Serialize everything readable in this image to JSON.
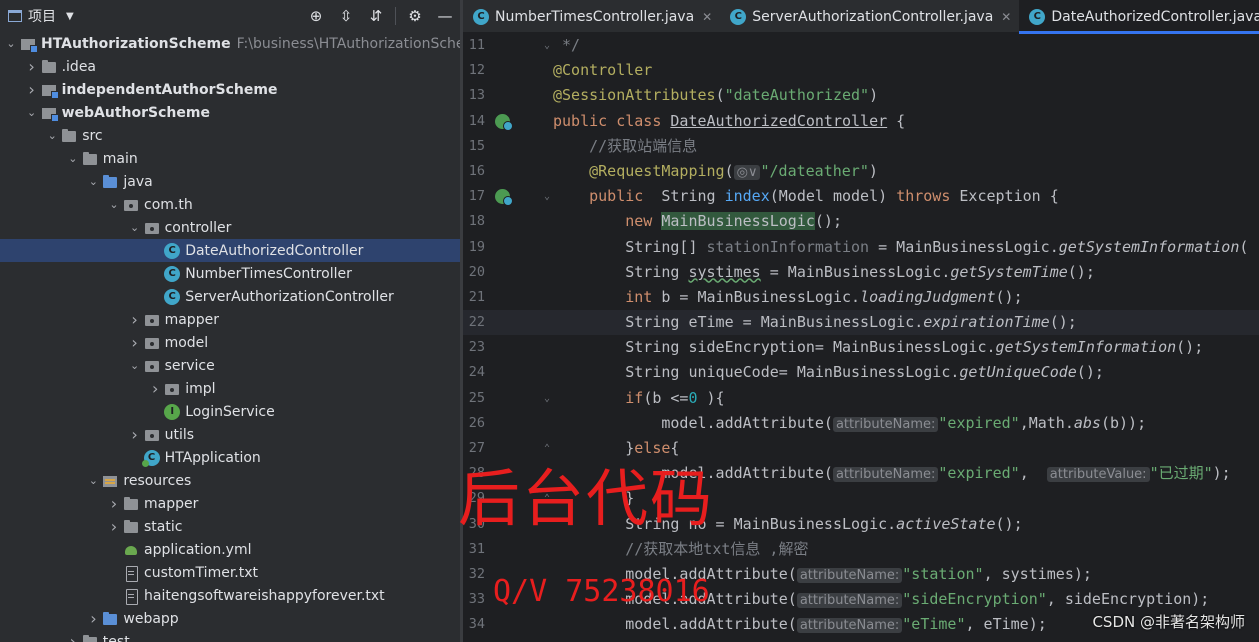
{
  "project_panel": {
    "title": "项目",
    "tree": [
      {
        "label": "HTAuthorizationScheme",
        "path": "F:\\business\\HTAuthorizationSchem",
        "depth": 0,
        "arrow": "down",
        "icon": "module-icon",
        "bold": true
      },
      {
        "label": ".idea",
        "depth": 1,
        "arrow": "right",
        "icon": "folder-icon"
      },
      {
        "label": "independentAuthorScheme",
        "depth": 1,
        "arrow": "right",
        "icon": "module-icon",
        "bold": true
      },
      {
        "label": "webAuthorScheme",
        "depth": 1,
        "arrow": "down",
        "icon": "module-icon",
        "bold": true
      },
      {
        "label": "src",
        "depth": 2,
        "arrow": "down",
        "icon": "folder-icon"
      },
      {
        "label": "main",
        "depth": 3,
        "arrow": "down",
        "icon": "folder-icon"
      },
      {
        "label": "java",
        "depth": 4,
        "arrow": "down",
        "icon": "source-folder-icon"
      },
      {
        "label": "com.th",
        "depth": 5,
        "arrow": "down",
        "icon": "package-icon"
      },
      {
        "label": "controller",
        "depth": 6,
        "arrow": "down",
        "icon": "package-icon"
      },
      {
        "label": "DateAuthorizedController",
        "depth": 7,
        "arrow": "none",
        "icon": "class-icon",
        "selected": true
      },
      {
        "label": "NumberTimesController",
        "depth": 7,
        "arrow": "none",
        "icon": "class-icon"
      },
      {
        "label": "ServerAuthorizationController",
        "depth": 7,
        "arrow": "none",
        "icon": "class-icon"
      },
      {
        "label": "mapper",
        "depth": 6,
        "arrow": "right",
        "icon": "package-icon"
      },
      {
        "label": "model",
        "depth": 6,
        "arrow": "right",
        "icon": "package-icon"
      },
      {
        "label": "service",
        "depth": 6,
        "arrow": "down",
        "icon": "package-icon"
      },
      {
        "label": "impl",
        "depth": 7,
        "arrow": "right",
        "icon": "package-icon"
      },
      {
        "label": "LoginService",
        "depth": 7,
        "arrow": "none",
        "icon": "interface-icon"
      },
      {
        "label": "utils",
        "depth": 6,
        "arrow": "right",
        "icon": "package-icon"
      },
      {
        "label": "HTApplication",
        "depth": 6,
        "arrow": "none",
        "icon": "spring-app-icon"
      },
      {
        "label": "resources",
        "depth": 4,
        "arrow": "down",
        "icon": "resources-folder-icon"
      },
      {
        "label": "mapper",
        "depth": 5,
        "arrow": "right",
        "icon": "folder-icon"
      },
      {
        "label": "static",
        "depth": 5,
        "arrow": "right",
        "icon": "folder-icon"
      },
      {
        "label": "application.yml",
        "depth": 5,
        "arrow": "none",
        "icon": "yaml-icon"
      },
      {
        "label": "customTimer.txt",
        "depth": 5,
        "arrow": "none",
        "icon": "text-file-icon"
      },
      {
        "label": "haitengsoftwareishappyforever.txt",
        "depth": 5,
        "arrow": "none",
        "icon": "text-file-icon"
      },
      {
        "label": "webapp",
        "depth": 4,
        "arrow": "right",
        "icon": "web-folder-icon"
      },
      {
        "label": "test",
        "depth": 3,
        "arrow": "right",
        "icon": "folder-icon"
      }
    ]
  },
  "tabs": [
    {
      "label": "NumberTimesController.java",
      "active": false
    },
    {
      "label": "ServerAuthorizationController.java",
      "active": false
    },
    {
      "label": "DateAuthorizedController.java",
      "active": true
    }
  ],
  "code": {
    "current_line": 22,
    "lines": [
      {
        "n": 11,
        "fold": "⌄",
        "tokens": [
          [
            "cm",
            " */"
          ]
        ]
      },
      {
        "n": 12,
        "tokens": [
          [
            "an",
            "@Controller"
          ]
        ]
      },
      {
        "n": 13,
        "tokens": [
          [
            "an",
            "@SessionAttributes"
          ],
          [
            "",
            "("
          ],
          [
            "str",
            "\"dateAuthorized\""
          ],
          [
            "",
            ")"
          ]
        ]
      },
      {
        "n": 14,
        "run": true,
        "tokens": [
          [
            "kw",
            "public class "
          ],
          [
            "ul",
            "DateAuthorizedController"
          ],
          [
            "",
            " {"
          ]
        ]
      },
      {
        "n": 15,
        "tokens": [
          [
            "cm",
            "    //获取站端信息"
          ]
        ]
      },
      {
        "n": 16,
        "tokens": [
          [
            "",
            "    "
          ],
          [
            "an",
            "@RequestMapping"
          ],
          [
            "",
            "("
          ],
          [
            "hint",
            "◎∨"
          ],
          [
            "str",
            "\"/dateather\""
          ],
          [
            "",
            ")"
          ]
        ]
      },
      {
        "n": 17,
        "run": true,
        "fold": "⌄",
        "tokens": [
          [
            "",
            "    "
          ],
          [
            "kw",
            "public"
          ],
          [
            "",
            "  String "
          ],
          [
            "fn",
            "index"
          ],
          [
            "",
            "(Model model) "
          ],
          [
            "kw",
            "throws"
          ],
          [
            "",
            " Exception {"
          ]
        ]
      },
      {
        "n": 18,
        "tokens": [
          [
            "",
            "        "
          ],
          [
            "kw",
            "new "
          ],
          [
            "hl",
            "MainBusinessLogic"
          ],
          [
            "",
            "();"
          ]
        ]
      },
      {
        "n": 19,
        "tokens": [
          [
            "",
            "        String[] "
          ],
          [
            "cm",
            "stationInformation"
          ],
          [
            "",
            " = MainBusinessLogic."
          ],
          [
            "it",
            "getSystemInformation"
          ],
          [
            "",
            "("
          ]
        ]
      },
      {
        "n": 20,
        "tokens": [
          [
            "",
            "        String "
          ],
          [
            "wv",
            "systimes"
          ],
          [
            "",
            " = MainBusinessLogic."
          ],
          [
            "it",
            "getSystemTime"
          ],
          [
            "",
            "();"
          ]
        ]
      },
      {
        "n": 21,
        "tokens": [
          [
            "",
            "        "
          ],
          [
            "kw",
            "int"
          ],
          [
            "",
            " b = MainBusinessLogic."
          ],
          [
            "it",
            "loadingJudgment"
          ],
          [
            "",
            "();"
          ]
        ]
      },
      {
        "n": 22,
        "tokens": [
          [
            "",
            "        String eTime = MainBusinessLogic."
          ],
          [
            "it",
            "expirationTime"
          ],
          [
            "",
            "();"
          ]
        ]
      },
      {
        "n": 23,
        "tokens": [
          [
            "",
            "        String sideEncryption= MainBusinessLogic."
          ],
          [
            "it",
            "getSystemInformation"
          ],
          [
            "",
            "();"
          ]
        ]
      },
      {
        "n": 24,
        "tokens": [
          [
            "",
            "        String uniqueCode= MainBusinessLogic."
          ],
          [
            "it",
            "getUniqueCode"
          ],
          [
            "",
            "();"
          ]
        ]
      },
      {
        "n": 25,
        "fold": "⌄",
        "tokens": [
          [
            "",
            "        "
          ],
          [
            "kw",
            "if"
          ],
          [
            "",
            "(b <="
          ],
          [
            "num",
            "0"
          ],
          [
            "",
            " ){"
          ]
        ]
      },
      {
        "n": 26,
        "tokens": [
          [
            "",
            "            model.addAttribute("
          ],
          [
            "hint",
            "attributeName:"
          ],
          [
            "str",
            "\"expired\""
          ],
          [
            "",
            ",Math."
          ],
          [
            "it",
            "abs"
          ],
          [
            "",
            "(b));"
          ]
        ]
      },
      {
        "n": 27,
        "fold": "⌃",
        "tokens": [
          [
            "",
            "        }"
          ],
          [
            "kw",
            "else"
          ],
          [
            "",
            "{"
          ]
        ]
      },
      {
        "n": 28,
        "tokens": [
          [
            "",
            "            model.addAttribute("
          ],
          [
            "hint",
            "attributeName:"
          ],
          [
            "str",
            "\"expired\""
          ],
          [
            "",
            ",  "
          ],
          [
            "hint",
            "attributeValue:"
          ],
          [
            "str",
            "\"已过期\""
          ],
          [
            "",
            ");"
          ]
        ]
      },
      {
        "n": 29,
        "fold": "⌃",
        "tokens": [
          [
            "",
            "        }"
          ]
        ]
      },
      {
        "n": 30,
        "tokens": [
          [
            "",
            "        String no = MainBusinessLogic."
          ],
          [
            "it",
            "activeState"
          ],
          [
            "",
            "();"
          ]
        ]
      },
      {
        "n": 31,
        "tokens": [
          [
            "cm",
            "        //获取本地txt信息 ,解密"
          ]
        ]
      },
      {
        "n": 32,
        "tokens": [
          [
            "",
            "        model.addAttribute("
          ],
          [
            "hint",
            "attributeName:"
          ],
          [
            "str",
            "\"station\""
          ],
          [
            "",
            ", systimes);"
          ]
        ]
      },
      {
        "n": 33,
        "tokens": [
          [
            "",
            "        model.addAttribute("
          ],
          [
            "hint",
            "attributeName:"
          ],
          [
            "str",
            "\"sideEncryption\""
          ],
          [
            "",
            ", sideEncryption);"
          ]
        ]
      },
      {
        "n": 34,
        "tokens": [
          [
            "",
            "        model.addAttribute("
          ],
          [
            "hint",
            "attributeName:"
          ],
          [
            "str",
            "\"eTime\""
          ],
          [
            "",
            ", eTime);"
          ]
        ]
      }
    ]
  },
  "overlay": {
    "title_text": "后台代码",
    "contact_text": "Q/V 75238016",
    "watermark": "CSDN @非著名架构师",
    "color": "#e81e1e"
  }
}
